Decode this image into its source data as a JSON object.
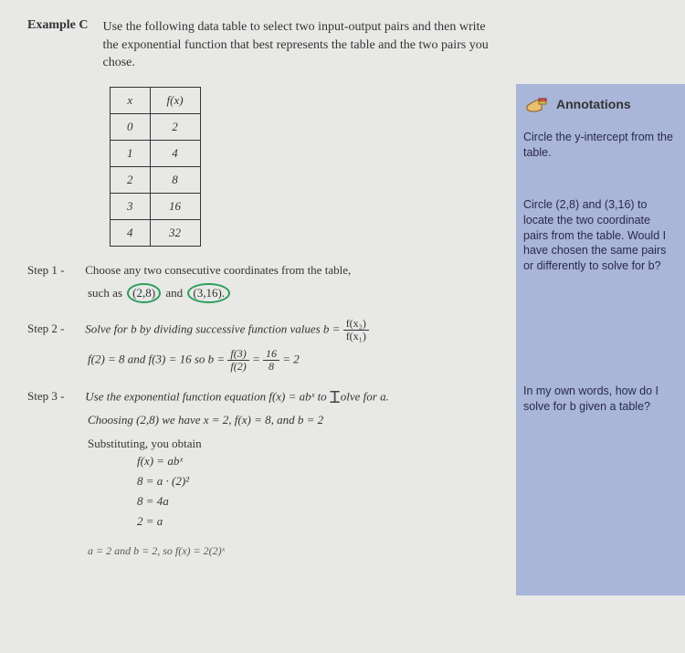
{
  "header": {
    "example_label": "Example C",
    "instruction": "Use the following data table to select two input-output pairs and then write the exponential function that best represents the table and the two pairs you chose."
  },
  "table": {
    "head_x": "x",
    "head_fx": "f(x)",
    "rows": [
      {
        "x": "0",
        "fx": "2"
      },
      {
        "x": "1",
        "fx": "4"
      },
      {
        "x": "2",
        "fx": "8"
      },
      {
        "x": "3",
        "fx": "16"
      },
      {
        "x": "4",
        "fx": "32"
      }
    ]
  },
  "step1": {
    "label": "Step 1 -",
    "text": "Choose any two consecutive coordinates from the table,",
    "text2a": "such as",
    "pair1": "(2,8)",
    "text2b": "and",
    "pair2": "(3,16).",
    "highlight_color": "#2a9d5a"
  },
  "step2": {
    "label": "Step 2 -",
    "text": "Solve for b by dividing successive function values b =",
    "frac_num": "f(x₂)",
    "frac_den": "f(x₁)",
    "line2a": "f(2) = 8 and f(3) = 16 so b =",
    "frac2_num": "f(3)",
    "frac2_den": "f(2)",
    "eq_mid": "=",
    "frac3_num": "16",
    "frac3_den": "8",
    "eq_end": "= 2"
  },
  "step3": {
    "label": "Step 3 -",
    "text": "Use the exponential function equation f(x) = abˣ to ",
    "text_after_cursor": "olve for a.",
    "line2": "Choosing (2,8) we have x = 2, f(x) = 8, and b = 2",
    "sub_title": "Substituting, you obtain",
    "eq1": "f(x) = abˣ",
    "eq2": "8 = a · (2)²",
    "eq3": "8 = 4a",
    "eq4": "2 = a",
    "final": "a = 2 and b = 2, so f(x) = 2(2)ˣ"
  },
  "annotations": {
    "title": "Annotations",
    "note1": "Circle the y-intercept from the table.",
    "note2": "Circle (2,8) and (3,16) to locate the two coordinate pairs from the table. Would I have chosen the same pairs or differently to solve for b?",
    "note3": "In my own words, how do I solve for b given a table?"
  }
}
